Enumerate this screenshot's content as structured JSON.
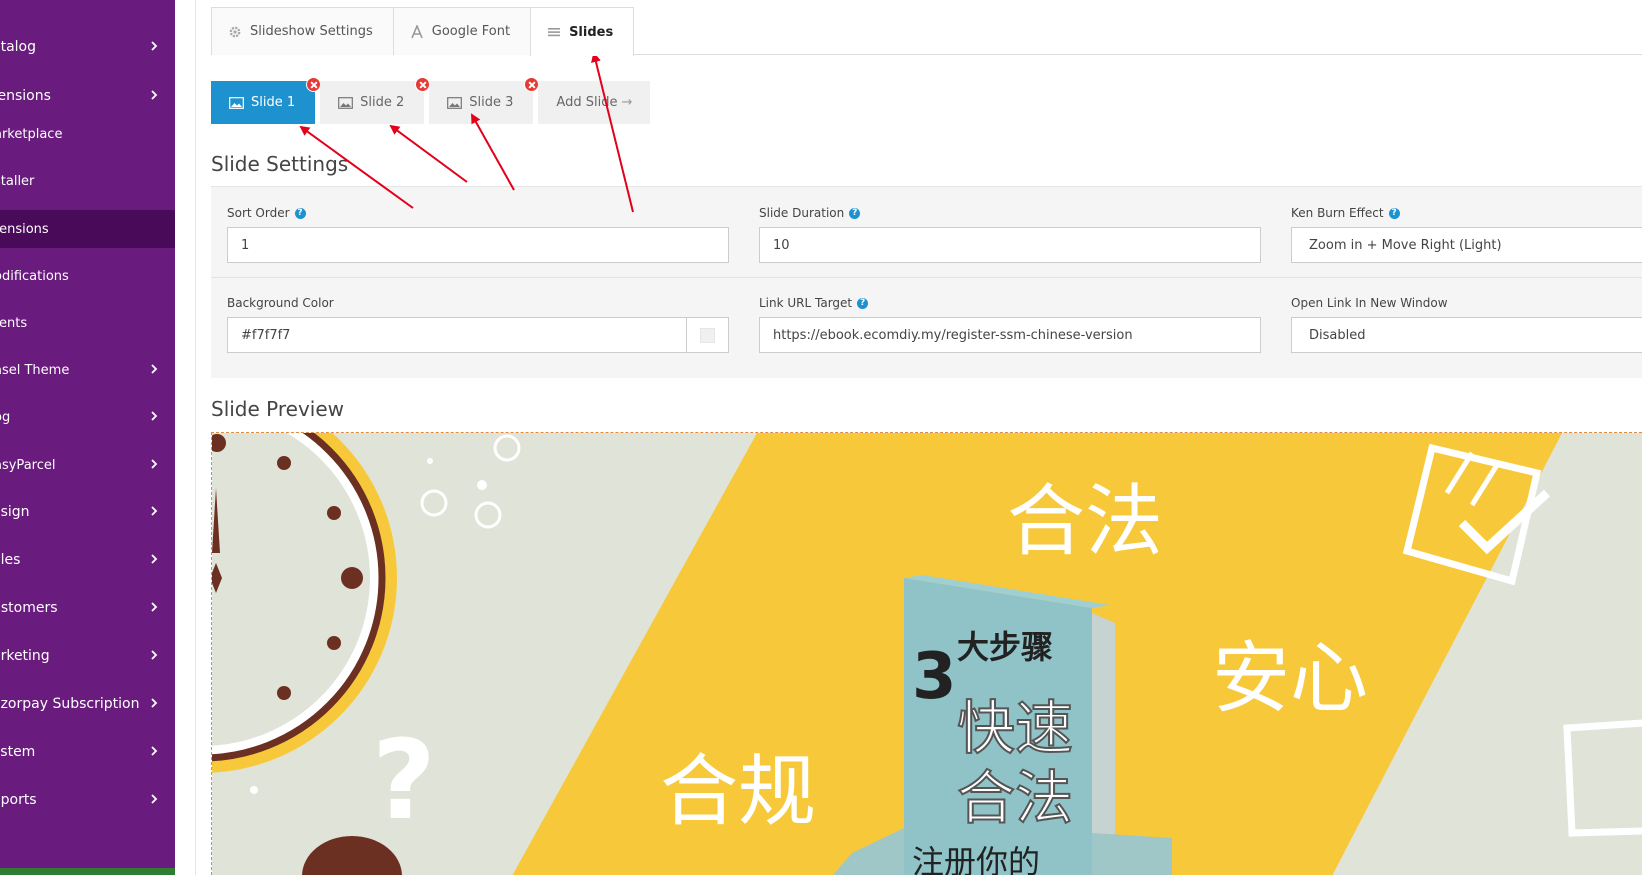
{
  "sidebar": {
    "items": [
      {
        "label": "atalog",
        "chevron": true,
        "active": false,
        "sub": false
      },
      {
        "label": "tensions",
        "chevron": true,
        "active": false,
        "sub": false
      },
      {
        "label": "arketplace",
        "chevron": false,
        "active": false,
        "sub": true
      },
      {
        "label": "staller",
        "chevron": false,
        "active": false,
        "sub": true
      },
      {
        "label": "tensions",
        "chevron": false,
        "active": true,
        "sub": true
      },
      {
        "label": "odifications",
        "chevron": false,
        "active": false,
        "sub": true
      },
      {
        "label": "rents",
        "chevron": false,
        "active": false,
        "sub": true
      },
      {
        "label": "asel Theme",
        "chevron": true,
        "active": false,
        "sub": true
      },
      {
        "label": "og",
        "chevron": true,
        "active": false,
        "sub": true
      },
      {
        "label": "asyParcel",
        "chevron": true,
        "active": false,
        "sub": true
      },
      {
        "label": "esign",
        "chevron": true,
        "active": false,
        "sub": false
      },
      {
        "label": "ales",
        "chevron": true,
        "active": false,
        "sub": false
      },
      {
        "label": "ustomers",
        "chevron": true,
        "active": false,
        "sub": false
      },
      {
        "label": "arketing",
        "chevron": true,
        "active": false,
        "sub": false
      },
      {
        "label": "azorpay Subscription",
        "chevron": true,
        "active": false,
        "sub": false
      },
      {
        "label": "ystem",
        "chevron": true,
        "active": false,
        "sub": false
      },
      {
        "label": "eports",
        "chevron": true,
        "active": false,
        "sub": false
      }
    ]
  },
  "top_tabs": [
    {
      "label": "Slideshow Settings",
      "icon": "gear-icon"
    },
    {
      "label": "Google Font",
      "icon": "font-icon"
    },
    {
      "label": "Slides",
      "icon": "list-icon",
      "active": true
    }
  ],
  "slide_tabs": [
    {
      "label": "Slide 1",
      "active": true
    },
    {
      "label": "Slide 2",
      "active": false
    },
    {
      "label": "Slide 3",
      "active": false
    }
  ],
  "add_slide_label": "Add Slide",
  "add_slide_arrow": "→",
  "headings": {
    "slide_settings": "Slide Settings",
    "slide_preview": "Slide Preview"
  },
  "fields": {
    "sort_order": {
      "label": "Sort Order",
      "value": "1"
    },
    "slide_duration": {
      "label": "Slide Duration",
      "value": "10"
    },
    "ken_burn": {
      "label": "Ken Burn Effect",
      "value": "Zoom in + Move Right (Light)"
    },
    "background_color": {
      "label": "Background Color",
      "value": "#f7f7f7"
    },
    "link_url": {
      "label": "Link URL Target",
      "value": "https://ebook.ecomdiy.my/register-ssm-chinese-version"
    },
    "open_new_window": {
      "label": "Open Link In New Window",
      "value": "Disabled"
    }
  },
  "help_glyph": "?",
  "preview": {
    "text_1": "合法",
    "text_2": "安心",
    "text_3": "合规",
    "book_number": "3",
    "book_line_1": "大步骤",
    "book_line_2": "快速",
    "book_line_3": "合法",
    "book_line_4": "注册你的",
    "question_mark": "?"
  },
  "colors": {
    "sidebar": "#6a1b7e",
    "sidebar_active": "#4a0a5a",
    "accent": "#1e91cf",
    "close_badge": "#e53935",
    "preview_yellow": "#f7c93a",
    "preview_gray": "#e0e3d8",
    "clock_brown": "#6b3021",
    "arrow_red": "#e3001b"
  }
}
